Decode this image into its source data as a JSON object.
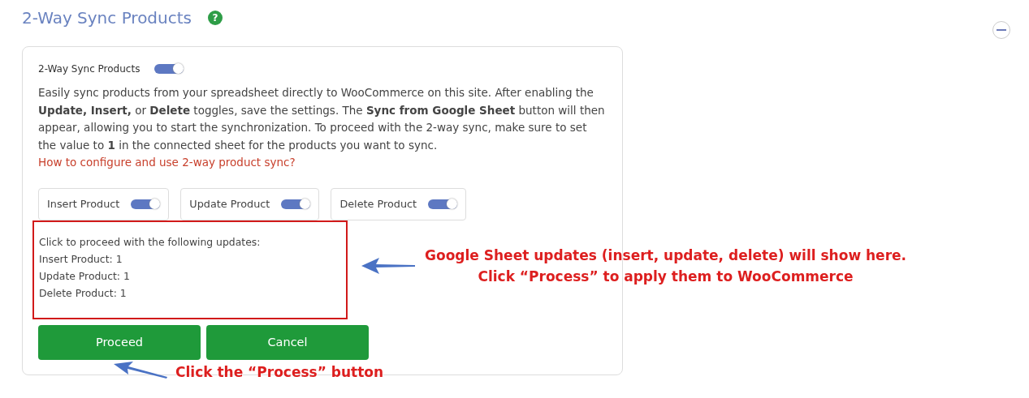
{
  "section": {
    "title": "2-Way Sync Products",
    "help": "?",
    "expanded": true
  },
  "card": {
    "master_toggle": {
      "label": "2-Way Sync Products",
      "on": true
    },
    "description": "Easily sync products from your spreadsheet directly to WooCommerce on this site. After enabling the **Update, Insert,** or **Delete** toggles, save the settings. The **Sync from Google Sheet** button will then appear, allowing you to start the synchronization. To proceed with the 2-way sync, make sure to set the value to **1** in the connected sheet for the products you want to sync.",
    "link": "How to configure and use 2-way product sync?",
    "toggles": [
      {
        "label": "Insert Product",
        "on": true
      },
      {
        "label": "Update Product",
        "on": true
      },
      {
        "label": "Delete Product",
        "on": true
      }
    ],
    "summary": {
      "heading": "Click to proceed with the following updates:",
      "lines": [
        "Insert Product: 1",
        "Update Product: 1",
        "Delete Product: 1"
      ]
    },
    "buttons": [
      "Proceed",
      "Cancel"
    ]
  },
  "annotations": [
    {
      "lines": [
        "Google Sheet updates (insert, update, delete) will show here.",
        "Click “Process” to apply them to WooCommerce"
      ]
    },
    {
      "lines": [
        "Click the “Process” button"
      ]
    }
  ]
}
